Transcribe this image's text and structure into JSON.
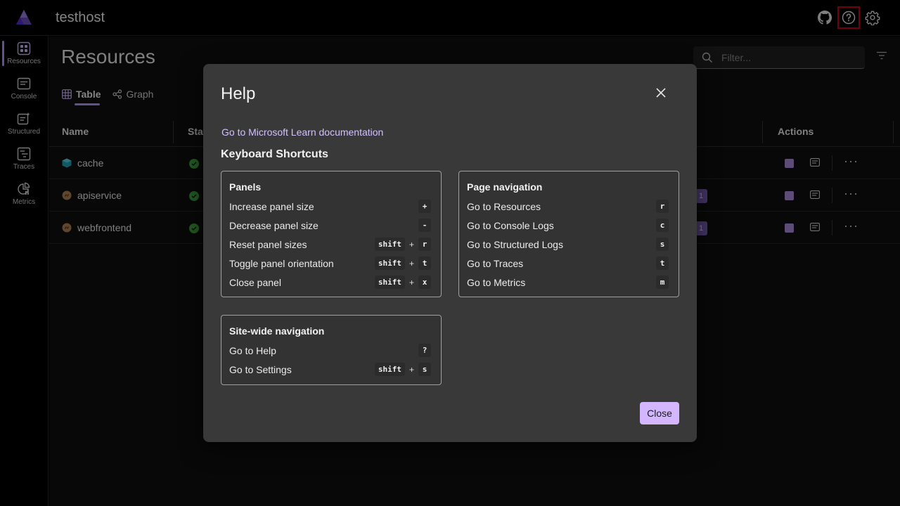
{
  "header": {
    "app_title": "testhost",
    "icons": [
      "github-icon",
      "help-icon",
      "settings-icon"
    ]
  },
  "rail": {
    "items": [
      {
        "label": "Resources",
        "icon": "resources-icon",
        "active": true
      },
      {
        "label": "Console",
        "icon": "console-icon",
        "active": false
      },
      {
        "label": "Structured",
        "icon": "structured-icon",
        "active": false
      },
      {
        "label": "Traces",
        "icon": "traces-icon",
        "active": false
      },
      {
        "label": "Metrics",
        "icon": "metrics-icon",
        "active": false
      }
    ]
  },
  "main": {
    "title": "Resources",
    "filter_placeholder": "Filter...",
    "tabs": [
      {
        "label": "Table",
        "active": true
      },
      {
        "label": "Graph",
        "active": false
      }
    ],
    "columns": {
      "name": "Name",
      "state": "Stat",
      "actions": "Actions"
    },
    "rows": [
      {
        "name": "cache",
        "badge": ""
      },
      {
        "name": "apiservice",
        "badge": "1"
      },
      {
        "name": "webfrontend",
        "badge": "1"
      }
    ]
  },
  "dialog": {
    "title": "Help",
    "learn_link": "Go to Microsoft Learn documentation",
    "shortcuts_heading": "Keyboard Shortcuts",
    "panels": {
      "title": "Panels",
      "rows": [
        {
          "label": "Increase panel size",
          "keys": [
            "+"
          ]
        },
        {
          "label": "Decrease panel size",
          "keys": [
            "-"
          ]
        },
        {
          "label": "Reset panel sizes",
          "keys": [
            "shift",
            "r"
          ]
        },
        {
          "label": "Toggle panel orientation",
          "keys": [
            "shift",
            "t"
          ]
        },
        {
          "label": "Close panel",
          "keys": [
            "shift",
            "x"
          ]
        }
      ]
    },
    "page_navigation": {
      "title": "Page navigation",
      "rows": [
        {
          "label": "Go to Resources",
          "keys": [
            "r"
          ]
        },
        {
          "label": "Go to Console Logs",
          "keys": [
            "c"
          ]
        },
        {
          "label": "Go to Structured Logs",
          "keys": [
            "s"
          ]
        },
        {
          "label": "Go to Traces",
          "keys": [
            "t"
          ]
        },
        {
          "label": "Go to Metrics",
          "keys": [
            "m"
          ]
        }
      ]
    },
    "site_navigation": {
      "title": "Site-wide navigation",
      "rows": [
        {
          "label": "Go to Help",
          "keys": [
            "?"
          ]
        },
        {
          "label": "Go to Settings",
          "keys": [
            "shift",
            "s"
          ]
        }
      ]
    },
    "close_label": "Close",
    "plus_sign": "+"
  },
  "colors": {
    "accent": "#b594ff",
    "close_button": "#d3b6ff",
    "link": "#d3c0ff",
    "running": "#3fa33f",
    "highlight_outline": "#d0021b"
  }
}
